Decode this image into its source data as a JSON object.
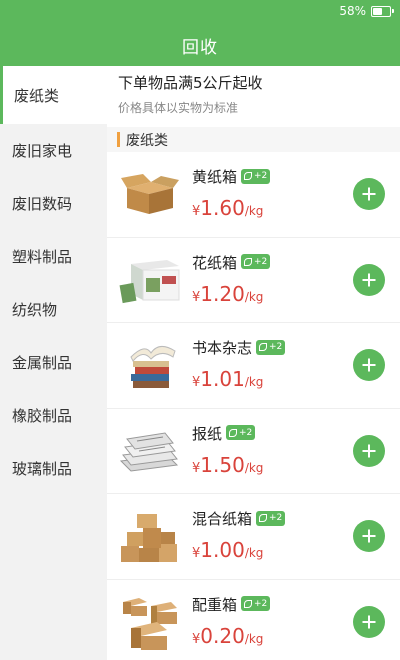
{
  "status_bar": {
    "battery": "58%"
  },
  "nav": {
    "title": "回收"
  },
  "sidebar": {
    "items": [
      {
        "label": "废纸类",
        "active": true
      },
      {
        "label": "废旧家电"
      },
      {
        "label": "废旧数码"
      },
      {
        "label": "塑料制品"
      },
      {
        "label": "纺织物"
      },
      {
        "label": "金属制品"
      },
      {
        "label": "橡胶制品"
      },
      {
        "label": "玻璃制品"
      }
    ]
  },
  "notice": {
    "title": "下单物品满5公斤起收",
    "subtitle": "价格具体以实物为标准"
  },
  "category": {
    "title": "废纸类"
  },
  "items": [
    {
      "name": "黄纸箱",
      "tag": "+2",
      "currency": "¥",
      "price": "1.60",
      "unit": "/kg"
    },
    {
      "name": "花纸箱",
      "tag": "+2",
      "currency": "¥",
      "price": "1.20",
      "unit": "/kg"
    },
    {
      "name": "书本杂志",
      "tag": "+2",
      "currency": "¥",
      "price": "1.01",
      "unit": "/kg"
    },
    {
      "name": "报纸",
      "tag": "+2",
      "currency": "¥",
      "price": "1.50",
      "unit": "/kg"
    },
    {
      "name": "混合纸箱",
      "tag": "+2",
      "currency": "¥",
      "price": "1.00",
      "unit": "/kg"
    },
    {
      "name": "配重箱",
      "tag": "+2",
      "currency": "¥",
      "price": "0.20",
      "unit": "/kg"
    }
  ],
  "colors": {
    "primary": "#5cb85c",
    "price": "#d9433b",
    "accent": "#f0a040"
  }
}
